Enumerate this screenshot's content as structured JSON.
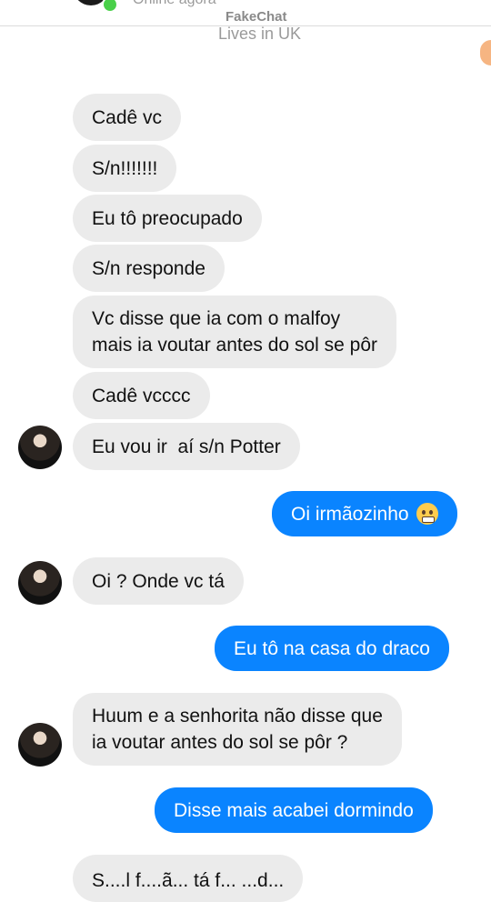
{
  "header": {
    "status": "Online agora",
    "watermark": "FakeChat",
    "subtitle": "Lives in UK"
  },
  "messages": [
    {
      "from": "contact",
      "text": "Cadê vc"
    },
    {
      "from": "contact",
      "text": "S/n!!!!!!!"
    },
    {
      "from": "contact",
      "text": "Eu tô preocupado"
    },
    {
      "from": "contact",
      "text": "S/n responde"
    },
    {
      "from": "contact",
      "lines": [
        "Vc disse que ia com o malfoy",
        "mais ia voutar antes do sol se pôr"
      ]
    },
    {
      "from": "contact",
      "text": "Cadê vcccc"
    },
    {
      "from": "contact",
      "text": "Eu vou ir  aí s/n Potter"
    },
    {
      "from": "me",
      "text": "Oi irmãozinho",
      "emoji": "grimacing-face"
    },
    {
      "from": "contact",
      "text": "Oi ? Onde vc tá"
    },
    {
      "from": "me",
      "text": "Eu tô na casa do draco"
    },
    {
      "from": "contact",
      "lines": [
        "Huum e a senhorita não disse que",
        "ia voutar antes do sol se pôr ?"
      ]
    },
    {
      "from": "me",
      "text": "Disse mais acabei dormindo"
    },
    {
      "from": "contact",
      "text": "S....l f....ã... tá f... ...d..."
    }
  ],
  "colors": {
    "outgoing_bubble": "#0a84ff",
    "incoming_bubble": "#ebebeb",
    "online_indicator": "#4ad04a"
  }
}
